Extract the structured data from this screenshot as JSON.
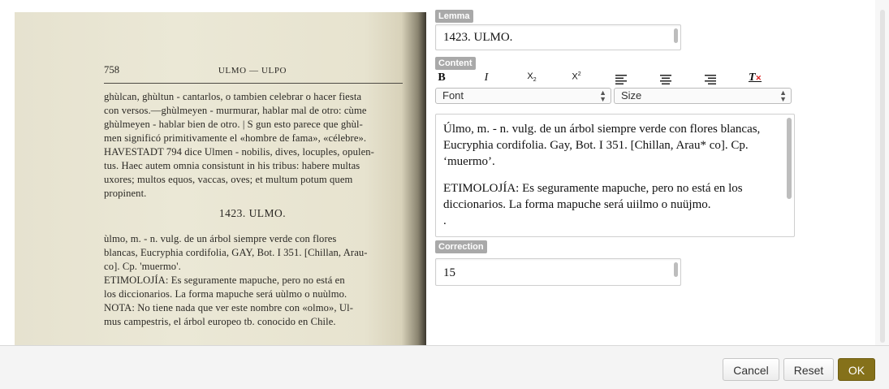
{
  "scan": {
    "page_number": "758",
    "running_head": "ULMO — ULPO",
    "lines": [
      "ghùlcan, ghùltun - cantarlos, o tambien celebrar o hacer fiesta",
      "con versos.—ghùlmeyen - murmurar, hablar  mal de otro: cùme",
      "ghùlmeyen - hablar bien de otro. | S gun esto parece  que ghùl-",
      "men significó primitivamente el «hombre de fama», «célebre».",
      "HAVESTADT 794 dice Ulmen - nobilis, dives, locuples, opulen-",
      "tus. Haec autem omnia consistunt in  his tribus: habere multas",
      "uxores; multos equos, vaccas, oves; et multum potum quem",
      "propinent."
    ],
    "heading": "1423. ULMO.",
    "lines2": [
      "ùlmo, m. - n. vulg. de un árbol siempre verde con flores",
      "blancas, Eucryphia cordifolia, GAY, Bot. I 351. [Chillan, Arau-",
      "co]. Cp. 'muermo'.",
      "ETIMOLOJÍA: Es seguramente mapuche, pero no está  en",
      "los diccionarios. La forma mapuche será uùlmo o nuùlmo.",
      "NOTA: No tiene nada que ver  este nombre con «olmo», Ul-",
      "mus campestris, el árbol europeo tb. conocido en Chile."
    ]
  },
  "form": {
    "lemma_label": "Lemma",
    "lemma_value": "1423. ULMO.",
    "content_label": "Content",
    "toolbar": {
      "bold": "B",
      "italic": "I",
      "subscript": "X",
      "sub_mark": "2",
      "superscript": "X",
      "sup_mark": "2",
      "remove_format": "T"
    },
    "font_select": "Font",
    "size_select": "Size",
    "content_paragraph_1": "Úlmo, m. - n. vulg. de un árbol siempre verde con flores blancas, Eucryphia cordifolia. Gay, Bot. I 351. [Chillan, Arau* co]. Cp. ‘muermo’.",
    "content_paragraph_2": "ETIMOLOJÍA: Es seguramente mapuche, pero no está en los diccionarios. La forma mapuche será uiilmo o nuüjmo.",
    "content_paragraph_3": ".",
    "correction_label": "Correction",
    "correction_value": "15"
  },
  "footer": {
    "cancel": "Cancel",
    "reset": "Reset",
    "ok": "OK"
  },
  "colors": {
    "ok_button": "#85711a",
    "label_bg": "#a9a9a9",
    "scan_paper": "#e8e4d1"
  }
}
